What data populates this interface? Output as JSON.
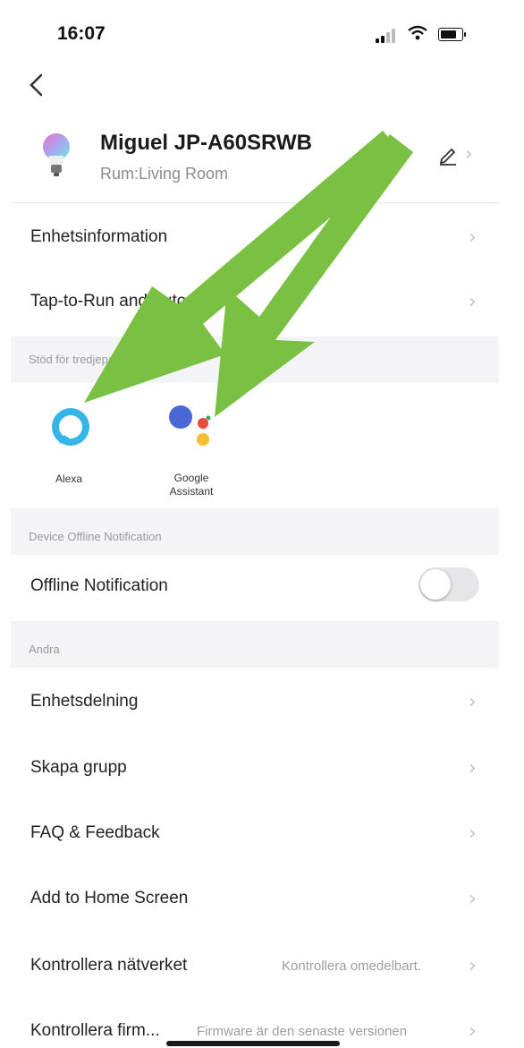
{
  "status_bar": {
    "time": "16:07"
  },
  "device": {
    "name": "Miguel JP-A60SRWB",
    "room": "Rum:Living Room"
  },
  "rows": {
    "device_info": "Enhetsinformation",
    "tap_to_run": "Tap-to-Run and Automation"
  },
  "third_party": {
    "section_label": "Stöd för tredjepartskontroll",
    "alexa": "Alexa",
    "google_line1": "Google",
    "google_line2": "Assistant"
  },
  "offline": {
    "section_label": "Device Offline Notification",
    "label": "Offline Notification",
    "enabled": false
  },
  "other": {
    "section_label": "Andra",
    "sharing": "Enhetsdelning",
    "create_group": "Skapa grupp",
    "faq": "FAQ & Feedback",
    "add_home": "Add to Home Screen",
    "check_network": "Kontrollera nätverket",
    "check_network_value": "Kontrollera omedelbart.",
    "check_firmware": "Kontrollera firm...",
    "check_firmware_value": "Firmware är den senaste versionen"
  },
  "colors": {
    "annotation_arrow": "#7ac143",
    "alexa": "#35b4e8",
    "section_bg": "#f4f4f6"
  }
}
